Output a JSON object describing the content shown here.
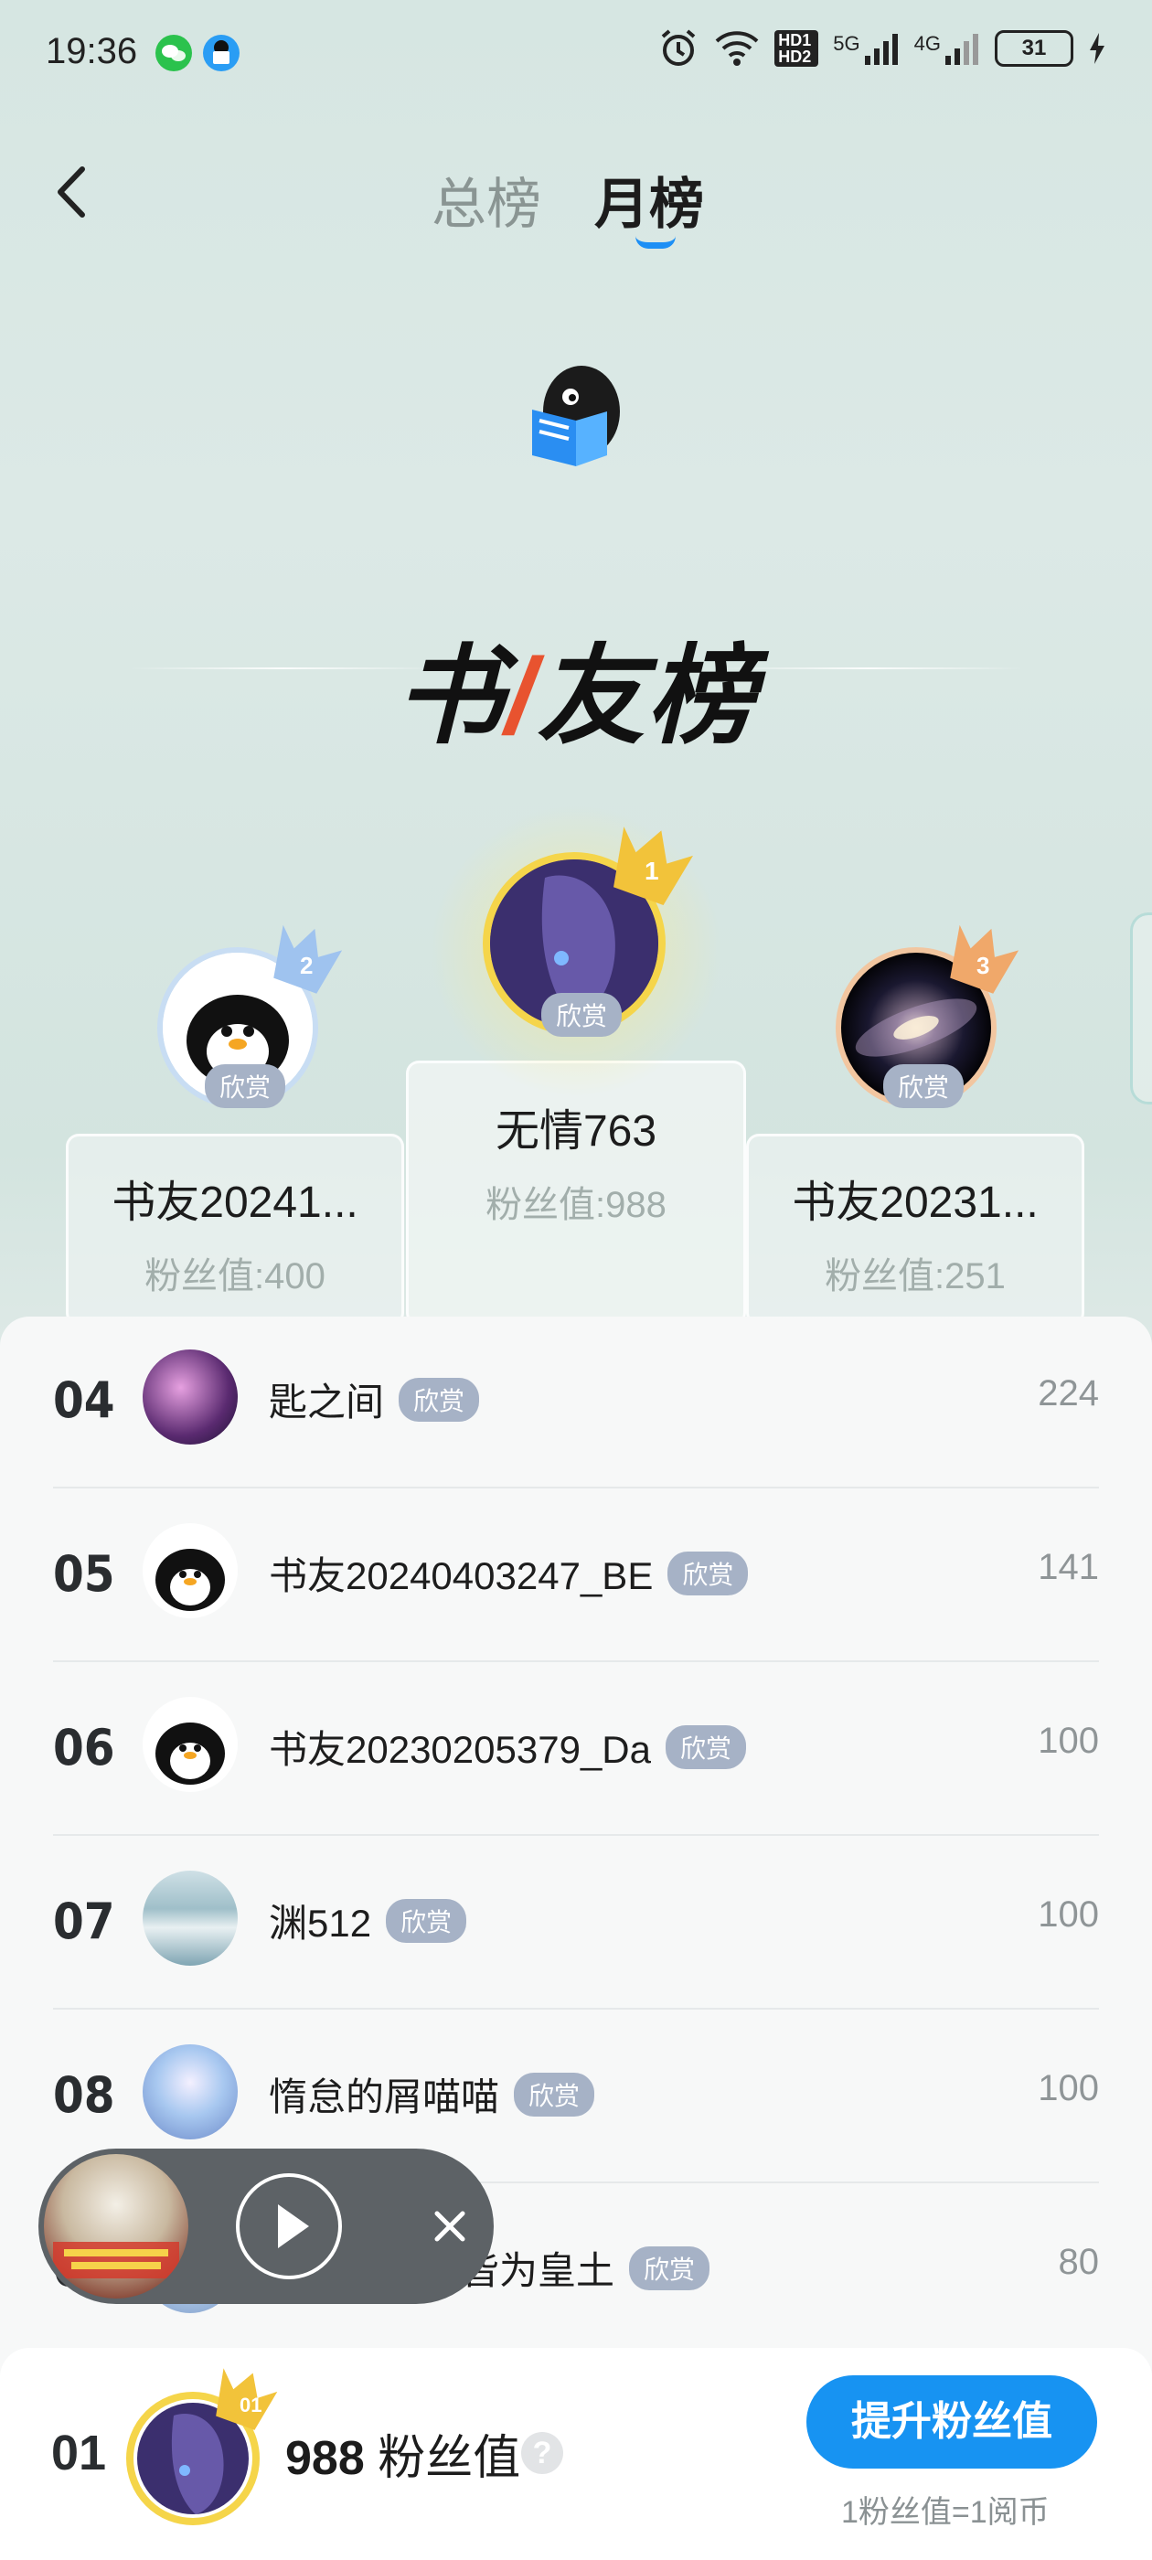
{
  "status_bar": {
    "time": "19:36",
    "icons": [
      "wechat-icon",
      "qq-reader-icon",
      "alarm-icon",
      "wifi-icon",
      "hd-icon",
      "signal-5g-icon",
      "signal-4g-icon",
      "battery-icon",
      "charging-icon"
    ],
    "hd_label": "HD1 HD2",
    "net_5g": "5G",
    "net_4g": "4G",
    "battery": "31"
  },
  "header": {
    "back_icon": "chevron-left-icon",
    "tabs": [
      {
        "label": "总榜",
        "active": false
      },
      {
        "label": "月榜",
        "active": true
      }
    ],
    "accent": "#1d8ff5"
  },
  "banner": {
    "title_part1": "书",
    "title_slash": "/",
    "title_part2": "友榜"
  },
  "podium": [
    {
      "rank": "2",
      "name": "书友20241...",
      "fans": "粉丝值:400",
      "badge": "欣赏",
      "crown_color": "#9fc3ef"
    },
    {
      "rank": "1",
      "name": "无情763",
      "fans": "粉丝值:988",
      "badge": "欣赏",
      "crown_color": "#f2c33a"
    },
    {
      "rank": "3",
      "name": "书友20231...",
      "fans": "粉丝值:251",
      "badge": "欣赏",
      "crown_color": "#f0a86a"
    }
  ],
  "list": [
    {
      "rank": "04",
      "name": "匙之间",
      "badge": "欣赏",
      "score": "224",
      "avatar": "anime-dark"
    },
    {
      "rank": "05",
      "name": "书友20240403247_BE",
      "badge": "欣赏",
      "score": "141",
      "avatar": "penguin"
    },
    {
      "rank": "06",
      "name": "书友20230205379_Da",
      "badge": "欣赏",
      "score": "100",
      "avatar": "penguin"
    },
    {
      "rank": "07",
      "name": "渊512",
      "badge": "欣赏",
      "score": "100",
      "avatar": "ice"
    },
    {
      "rank": "08",
      "name": "惰怠的屑喵喵",
      "badge": "欣赏",
      "score": "100",
      "avatar": "anime-blue"
    },
    {
      "rank": "09",
      "name": "视之所及，皆为皇土",
      "badge": "欣赏",
      "score": "80",
      "avatar": "anime-blue"
    }
  ],
  "mini_player": {
    "play_icon": "play-icon",
    "close_icon": "close-icon"
  },
  "my_rank": {
    "rank": "01",
    "fans_value": "988",
    "fans_unit": "粉丝值",
    "help": "?",
    "boost_label": "提升粉丝值",
    "note": "1粉丝值=1阅币"
  }
}
